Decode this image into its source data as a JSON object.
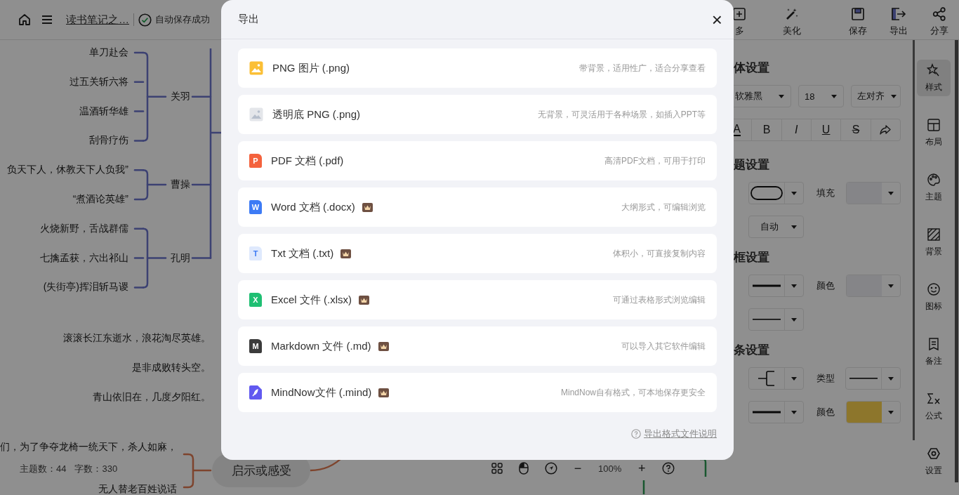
{
  "topbar": {
    "title": "读书笔记之…",
    "save_status": "自动保存成功",
    "edit_tools": [
      {
        "kind": "more",
        "label": "多"
      },
      {
        "kind": "beautify",
        "label": "美化"
      }
    ],
    "file_tools": [
      {
        "kind": "save",
        "label": "保存"
      },
      {
        "kind": "export",
        "label": "导出"
      },
      {
        "kind": "share",
        "label": "分享"
      }
    ]
  },
  "mind_map": {
    "groups": [
      {
        "label": "关羽",
        "children": [
          "单刀赴会",
          "过五关斩六将",
          "温酒斩华雄",
          "刮骨疗伤"
        ]
      },
      {
        "label": "曹操",
        "children": [
          "负天下人，休教天下人负我”",
          "“煮酒论英雄”"
        ]
      },
      {
        "label": "孔明",
        "children": [
          "火烧新野，舌战群儒",
          "七擒孟获，六出祁山",
          "(失街亭)挥泪斩马谡"
        ]
      }
    ],
    "verses": [
      "滚滚长江东逝水，浪花淘尽英雄。",
      "是非成败转头空。",
      "青山依旧在，几度夕阳红。"
    ],
    "bottom_branch": {
      "label": "启示或感受",
      "children": [
        "们，为了争夺龙椅一统天下，杀人如麻，",
        "无人替老百姓说话"
      ]
    }
  },
  "status_bar": {
    "topics": "主题数：44",
    "chars": "字数：330"
  },
  "zoom_bar": {
    "minus": "−",
    "zoom": "100%",
    "plus": "+"
  },
  "style_panel": {
    "sections": [
      {
        "title": "体设置",
        "rows": [
          {
            "kind": "selects",
            "controls": [
              {
                "kind": "text-select",
                "value": "软雅黑"
              },
              {
                "kind": "text-select",
                "value": "18"
              },
              {
                "kind": "text-select",
                "value": "左对齐"
              }
            ]
          },
          {
            "kind": "format",
            "buttons": [
              {
                "kind": "font-color",
                "label": "A"
              },
              {
                "kind": "bold",
                "label": "B"
              },
              {
                "kind": "italic",
                "label": "I"
              },
              {
                "kind": "underline",
                "label": "U"
              },
              {
                "kind": "strike",
                "label": "S"
              },
              {
                "kind": "painter"
              }
            ]
          }
        ]
      },
      {
        "title": "题设置",
        "rows": [
          {
            "kind": "labelled",
            "controls": [
              {
                "kind": "shape-select"
              },
              {
                "kind": "label",
                "text": "填充"
              },
              {
                "kind": "color-select",
                "color": "#858588"
              }
            ]
          },
          {
            "kind": "labelled",
            "controls": [
              {
                "kind": "text-select",
                "value": "自动"
              }
            ]
          }
        ]
      },
      {
        "title": "框设置",
        "rows": [
          {
            "kind": "labelled",
            "controls": [
              {
                "kind": "thick-line-select"
              },
              {
                "kind": "label",
                "text": "颜色"
              },
              {
                "kind": "color-select",
                "color": "#858588"
              }
            ]
          },
          {
            "kind": "labelled",
            "controls": [
              {
                "kind": "thin-line-select"
              }
            ]
          }
        ]
      },
      {
        "title": "条设置",
        "rows": [
          {
            "kind": "labelled",
            "controls": [
              {
                "kind": "bracket-select"
              },
              {
                "kind": "label",
                "text": "类型"
              },
              {
                "kind": "thin-line-select"
              }
            ]
          },
          {
            "kind": "labelled",
            "controls": [
              {
                "kind": "thick-line-select"
              },
              {
                "kind": "label",
                "text": "颜色"
              },
              {
                "kind": "color-select",
                "color": "#8d762c"
              }
            ]
          }
        ]
      }
    ]
  },
  "sidebar": {
    "items": [
      {
        "kind": "style",
        "label": "样式",
        "selected": true
      },
      {
        "kind": "layout",
        "label": "布局",
        "selected": false
      },
      {
        "kind": "theme",
        "label": "主题",
        "selected": false
      },
      {
        "kind": "background",
        "label": "背景",
        "selected": false
      },
      {
        "kind": "icon",
        "label": "图标",
        "selected": false
      },
      {
        "kind": "note",
        "label": "备注",
        "selected": false
      },
      {
        "kind": "formula",
        "label": "公式",
        "selected": false
      },
      {
        "kind": "settings",
        "label": "设置",
        "selected": false
      }
    ]
  },
  "export_dialog": {
    "title": "导出",
    "close": "×",
    "formats": [
      {
        "kind": "png",
        "name": "PNG 图片 (.png)",
        "vip": false,
        "description": "带背景，适用性广，适合分享查看"
      },
      {
        "kind": "png-transparent",
        "name": "透明底 PNG (.png)",
        "vip": false,
        "description": "无背景，可灵活用于各种场景，如插入PPT等"
      },
      {
        "kind": "pdf",
        "name": "PDF 文档 (.pdf)",
        "vip": false,
        "icon_letter": "P",
        "description": "高清PDF文档，可用于打印"
      },
      {
        "kind": "word",
        "name": "Word 文档 (.docx)",
        "vip": true,
        "icon_letter": "W",
        "description": "大纲形式，可编辑浏览"
      },
      {
        "kind": "txt",
        "name": "Txt 文档 (.txt)",
        "vip": true,
        "icon_letter": "T",
        "description": "体积小，可直接复制内容"
      },
      {
        "kind": "excel",
        "name": "Excel 文件 (.xlsx)",
        "vip": true,
        "icon_letter": "X",
        "description": "可通过表格形式浏览编辑"
      },
      {
        "kind": "markdown",
        "name": "Markdown 文件 (.md)",
        "vip": true,
        "icon_letter": "M",
        "description": "可以导入其它软件编辑"
      },
      {
        "kind": "mindnow",
        "name": "MindNow文件 (.mind)",
        "vip": true,
        "description": "MindNow自有格式，可本地保存更安全"
      }
    ],
    "help_link": "导出格式文件说明"
  }
}
